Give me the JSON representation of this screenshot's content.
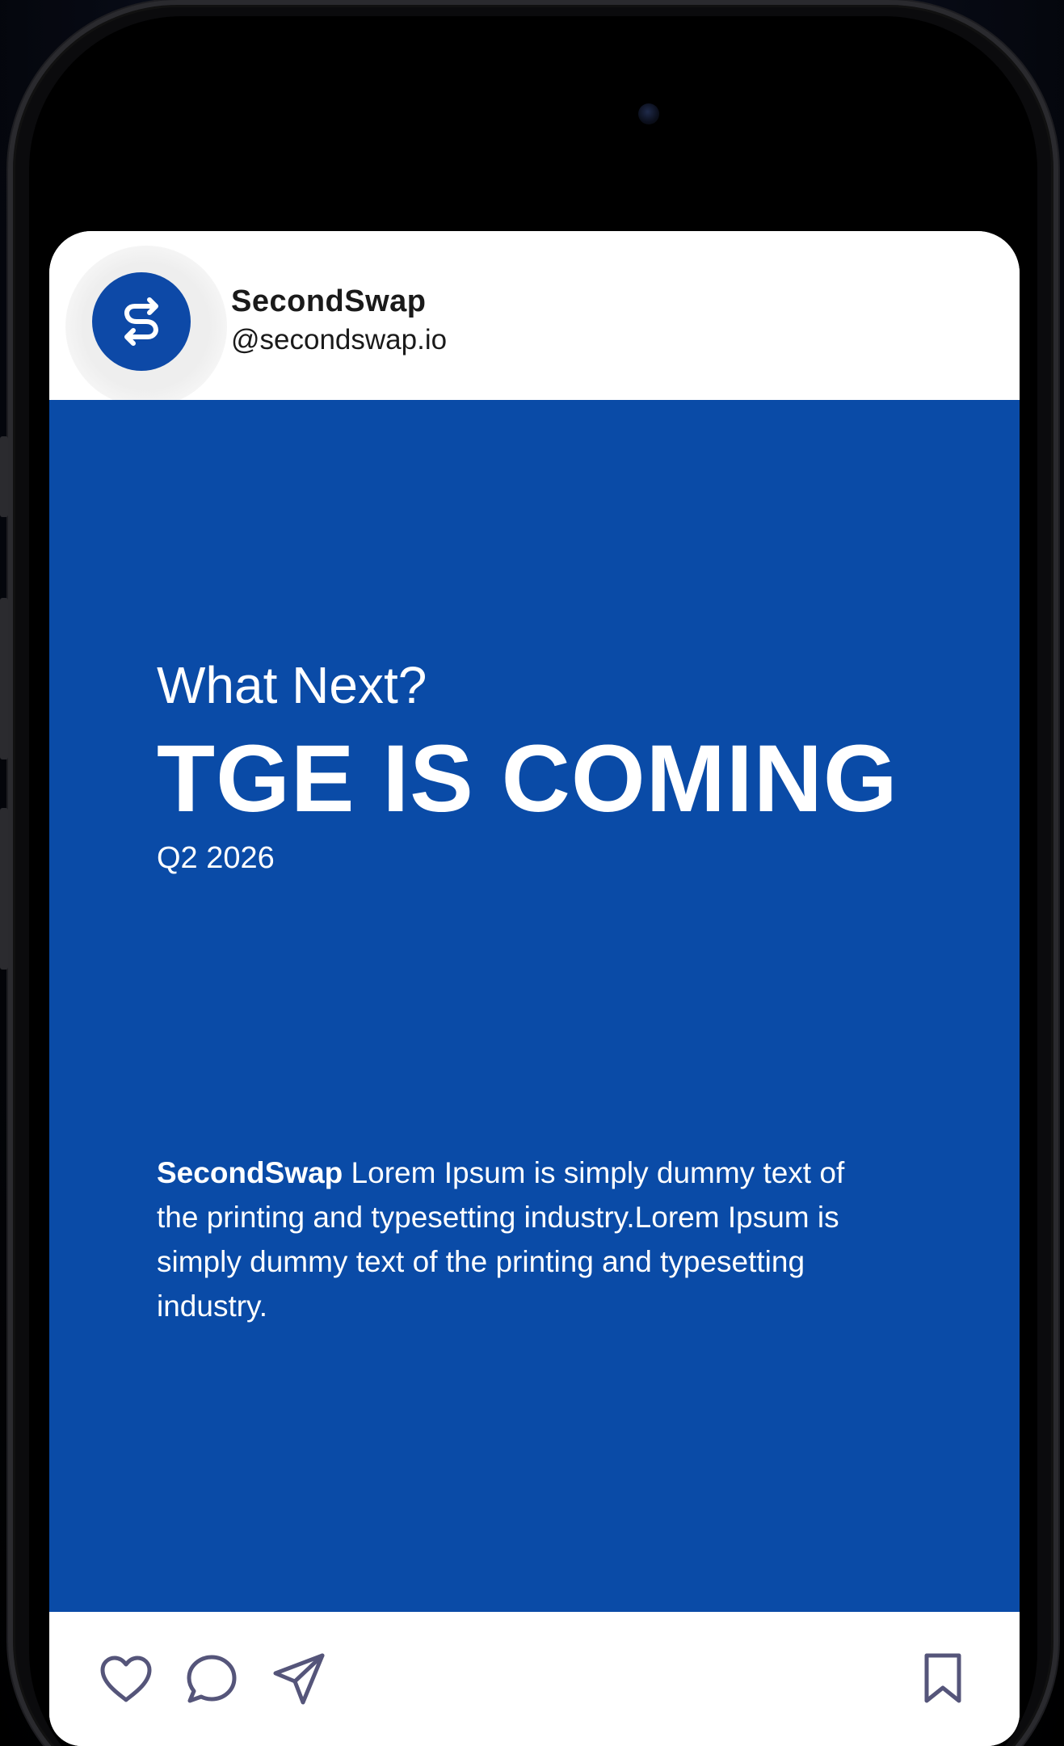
{
  "post": {
    "account_name": "SecondSwap",
    "account_handle": "@secondswap.io",
    "subtitle": "What Next?",
    "headline": "TGE IS COMING",
    "date": "Q2 2026",
    "body_brand": "SecondSwap",
    "body_text": " Lorem Ipsum is simply dummy text of the printing and typesetting industry.Lorem Ipsum is simply dummy text of the printing and typesetting industry."
  },
  "icons": {
    "avatar_logo": "secondswap-logo-icon",
    "like": "heart-icon",
    "comment": "comment-bubble-icon",
    "share": "send-icon",
    "save": "bookmark-icon"
  },
  "colors": {
    "brand_blue": "#0a4ba7",
    "avatar_blue": "#0d49a7",
    "icon_stroke": "#55557a",
    "text_dark": "#1a1a1a"
  }
}
